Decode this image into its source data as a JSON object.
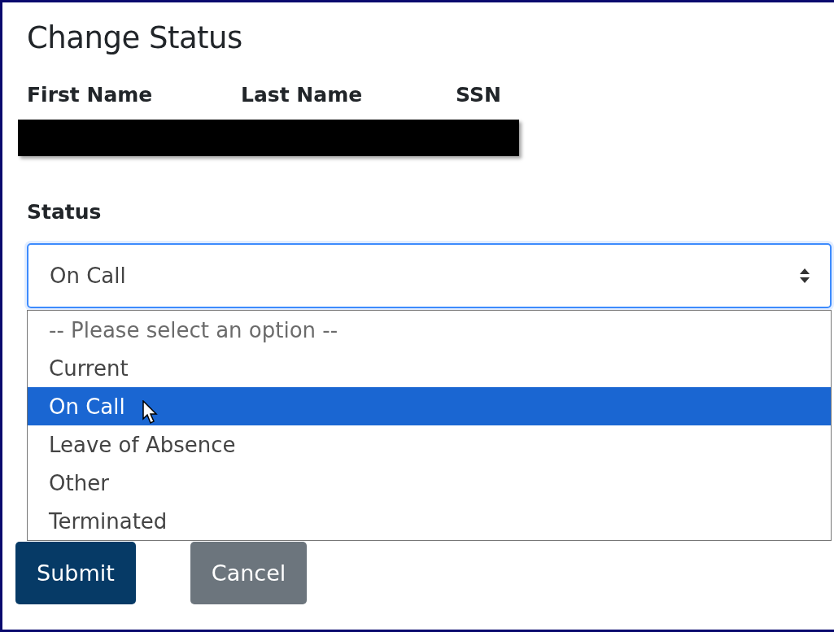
{
  "title": "Change Status",
  "columns": [
    "First Name",
    "Last Name",
    "SSN"
  ],
  "status": {
    "label": "Status",
    "value": "On Call",
    "expanded": true,
    "options": [
      {
        "label": "-- Please select an option --",
        "kind": "placeholder",
        "selected": false
      },
      {
        "label": "Current",
        "kind": "option",
        "selected": false
      },
      {
        "label": "On Call",
        "kind": "option",
        "selected": true
      },
      {
        "label": "Leave of Absence",
        "kind": "option",
        "selected": false
      },
      {
        "label": "Other",
        "kind": "option",
        "selected": false
      },
      {
        "label": "Terminated",
        "kind": "option",
        "selected": false
      }
    ]
  },
  "buttons": [
    {
      "label": "Submit",
      "kind": "primary"
    },
    {
      "label": "Cancel",
      "kind": "secondary"
    }
  ]
}
